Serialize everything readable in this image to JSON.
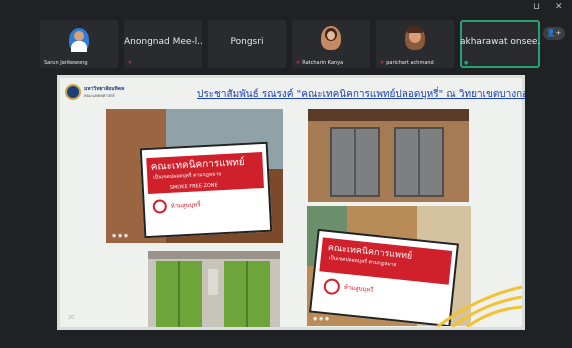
{
  "window_controls": {
    "restore": "⊔",
    "close": "✕"
  },
  "participants": [
    {
      "name": "Sarun Jarikewong",
      "muted": false,
      "type": "avatar",
      "color": "#2f7bd6"
    },
    {
      "name": "Anongnad Mee-l...",
      "muted": true,
      "type": "name"
    },
    {
      "name": "Pongsri",
      "muted": false,
      "type": "name"
    },
    {
      "name": "Ratcharin Kanya",
      "muted": true,
      "type": "avatar",
      "color": "#c58a62"
    },
    {
      "name": "parichart achmand",
      "muted": true,
      "type": "avatar",
      "color": "#8a5a3b"
    },
    {
      "name": "akharawat onsee...",
      "muted": false,
      "type": "name",
      "active": true
    }
  ],
  "more_participants_icon": "person-plus-icon",
  "slide": {
    "institution_line1": "มหาวิทยาลัยมหิดล",
    "institution_line2": "คณะแพทยศาสตร์",
    "headline": "ประชาสัมพันธ์ รณรงค์ \"คณะเทคนิคการแพทย์ปลอดบุหรี่\" ณ วิทยาเขตบางกอกน้อย",
    "sign_title": "คณะเทคนิคการแพทย์",
    "sign_sub": "เป็นเขตปลอดบุหรี่ ตามกฎหมาย",
    "sign_en": "SMOKE FREE ZONE",
    "sign_tag": "ห้ามสูบบุหรี่",
    "page_number": "20"
  },
  "colors": {
    "accent_red": "#d0202b",
    "elevator_green": "#6ea53b",
    "active_outline": "#25a36f",
    "headline_blue": "#1d3fb8",
    "swoosh_gold": "#f2c230"
  }
}
